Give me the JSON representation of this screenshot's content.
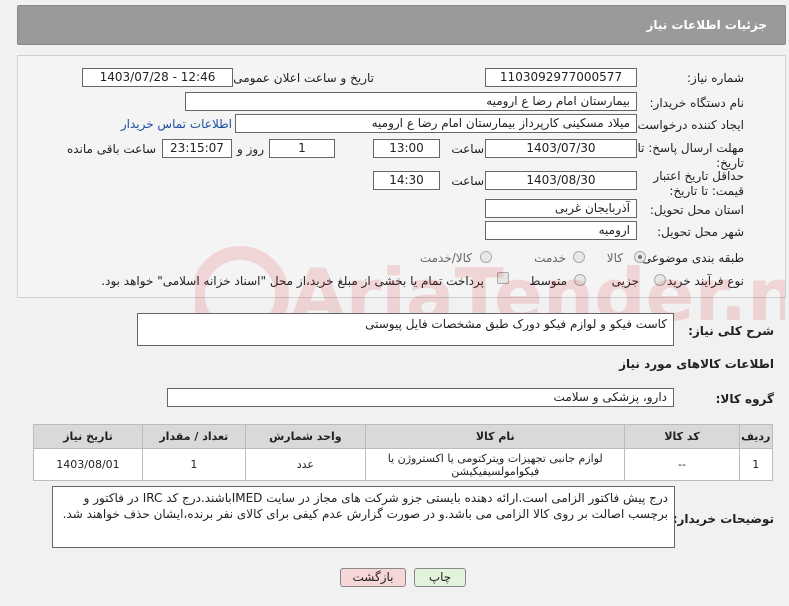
{
  "header": {
    "title": "جزئیات اطلاعات نیاز"
  },
  "form": {
    "need_number_label": "شماره نیاز:",
    "need_number": "1103092977000577",
    "announce_label": "تاریخ و ساعت اعلان عمومی:",
    "announce_value": "1403/07/28 - 12:46",
    "buyer_org_label": "نام دستگاه خریدار:",
    "buyer_org": "بیمارستان امام رضا  ع  ارومیه",
    "creator_label": "ایجاد کننده درخواست:",
    "creator": "میلاد مسکینی کارپرداز بیمارستان امام رضا  ع  ارومیه",
    "contact_link": "اطلاعات تماس خریدار",
    "deadline_label": "مهلت ارسال پاسخ: تا تاریخ:",
    "deadline_date": "1403/07/30",
    "time_label": "ساعت",
    "deadline_time": "13:00",
    "days_value": "1",
    "days_label": "روز و",
    "remaining_value": "23:15:07",
    "remaining_label": "ساعت باقی مانده",
    "validity_label": "حداقل تاریخ اعتبار قیمت: تا تاریخ:",
    "validity_date": "1403/08/30",
    "validity_time": "14:30",
    "province_label": "استان محل تحویل:",
    "province": "آذربایجان غربی",
    "city_label": "شهر محل تحویل:",
    "city": "ارومیه",
    "category_label": "طبقه بندی موضوعی:",
    "category_options": [
      "کالا",
      "خدمت",
      "کالا/خدمت"
    ],
    "process_label": "نوع فرآیند خرید :",
    "process_options": [
      "جزیی",
      "متوسط"
    ],
    "payment_note": "پرداخت تمام یا بخشی از مبلغ خرید،از محل \"اسناد خزانه اسلامی\" خواهد بود."
  },
  "description": {
    "label": "شرح کلی نیاز:",
    "value": "کاست فیکو و لوازم فیکو دورک طبق مشخصات فایل پیوستی"
  },
  "goods": {
    "section_title": "اطلاعات کالاهای مورد نیاز",
    "group_label": "گروه کالا:",
    "group_value": "دارو، پزشکی و سلامت",
    "columns": [
      "ردیف",
      "کد کالا",
      "نام کالا",
      "واحد شمارش",
      "تعداد / مقدار",
      "تاریخ نیاز"
    ],
    "rows": [
      {
        "row": "1",
        "code": "--",
        "name": "لوازم جانبی تجهیزات ویترکتومی یا اکستروژن یا فیکوامولسیفیکیشن",
        "unit": "عدد",
        "qty": "1",
        "date": "1403/08/01"
      }
    ]
  },
  "buyer_notes": {
    "label": "توضیحات خریدار:",
    "value": "درج پیش فاکتور الزامی است.ارائه دهنده بایستی جزو شرکت های مجاز در سایت IMEDباشند.درج کد IRC در فاکتور و برچسب اصالت بر روی کالا الزامی می باشد.و در صورت گزارش عدم کیفی برای کالای نفر برنده،ایشان حذف خواهند شد."
  },
  "buttons": {
    "print": "چاپ",
    "back": "بازگشت"
  },
  "watermark": "AriaTender.neT",
  "colors": {
    "header": "#9a9a9a",
    "link": "#1a4fa0",
    "back_button": "#f6d6d6",
    "print_button": "#e2f3dc"
  }
}
